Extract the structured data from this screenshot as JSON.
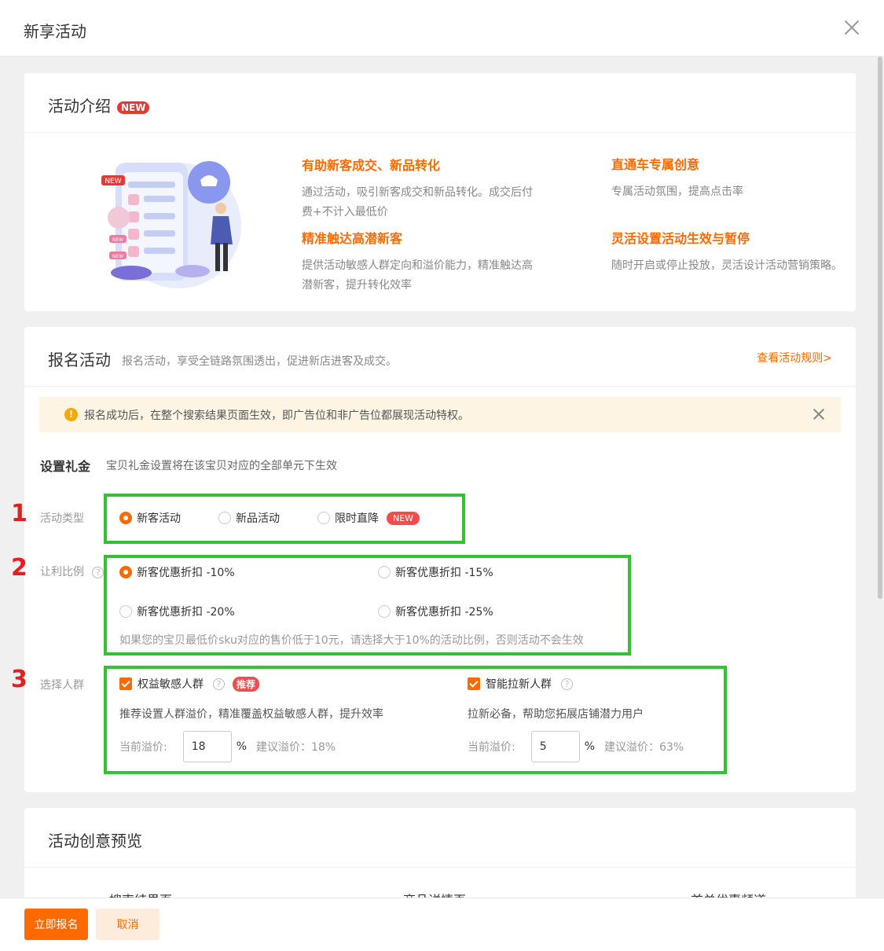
{
  "modal": {
    "title": "新享活动"
  },
  "intro": {
    "title": "活动介绍",
    "badge": "NEW",
    "features": [
      {
        "title": "有助新客成交、新品转化",
        "desc": "通过活动，吸引新客成交和新品转化。成交后付费+不计入最低价"
      },
      {
        "title": "直通车专属创意",
        "desc": "专属活动氛围，提高点击率"
      },
      {
        "title": "精准触达高潜新客",
        "desc": "提供活动敏感人群定向和溢价能力，精准触达高潜新客，提升转化效率"
      },
      {
        "title": "灵活设置活动生效与暂停",
        "desc": "随时开启或停止投放，灵活设计活动营销策略。"
      }
    ],
    "illustration_badges": [
      "NEW",
      "NEW",
      "NEW"
    ]
  },
  "signup": {
    "title": "报名活动",
    "desc": "报名活动，享受全链路氛围透出，促进新店进客及成交。",
    "rules_link": "查看活动规则>",
    "notice": {
      "icon": "!",
      "text": "报名成功后，在整个搜索结果页面生效，即广告位和非广告位都展现活动特权。"
    },
    "gift": {
      "title": "设置礼金",
      "desc": "宝贝礼金设置将在该宝贝对应的全部单元下生效"
    },
    "markers": [
      "1",
      "2",
      "3"
    ],
    "activity_type": {
      "label": "活动类型",
      "options": [
        {
          "label": "新客活动",
          "checked": true
        },
        {
          "label": "新品活动",
          "checked": false
        },
        {
          "label": "限时直降",
          "checked": false,
          "badge": "NEW"
        }
      ]
    },
    "discount": {
      "label": "让利比例",
      "help": "?",
      "options": [
        {
          "label": "新客优惠折扣 -10%",
          "checked": true
        },
        {
          "label": "新客优惠折扣 -15%",
          "checked": false
        },
        {
          "label": "新客优惠折扣 -20%",
          "checked": false
        },
        {
          "label": "新客优惠折扣 -25%",
          "checked": false
        }
      ],
      "hint": "如果您的宝贝最低价sku对应的售价低于10元，请选择大于10%的活动比例，否则活动不会生效"
    },
    "crowd": {
      "label": "选择人群",
      "groups": [
        {
          "label": "权益敏感人群",
          "help": "?",
          "badge": "推荐",
          "desc": "推荐设置人群溢价，精准覆盖权益敏感人群，提升效率",
          "premium_label": "当前溢价:",
          "premium_value": "18",
          "unit": "%",
          "suggest": "建议溢价：18%"
        },
        {
          "label": "智能拉新人群",
          "help": "?",
          "badge": "",
          "desc": "拉新必备，帮助您拓展店铺潜力用户",
          "premium_label": "当前溢价:",
          "premium_value": "5",
          "unit": "%",
          "suggest": "建议溢价：63%"
        }
      ]
    }
  },
  "preview": {
    "title": "活动创意预览",
    "tabs": [
      "搜索结果页",
      "商品详情页",
      "首单优惠频道"
    ]
  },
  "footer": {
    "submit": "立即报名",
    "cancel": "取消"
  },
  "colors": {
    "accent": "#ff6a00",
    "highlight_box": "#35c135",
    "marker": "#e32020",
    "badge": "#f04d4d"
  }
}
